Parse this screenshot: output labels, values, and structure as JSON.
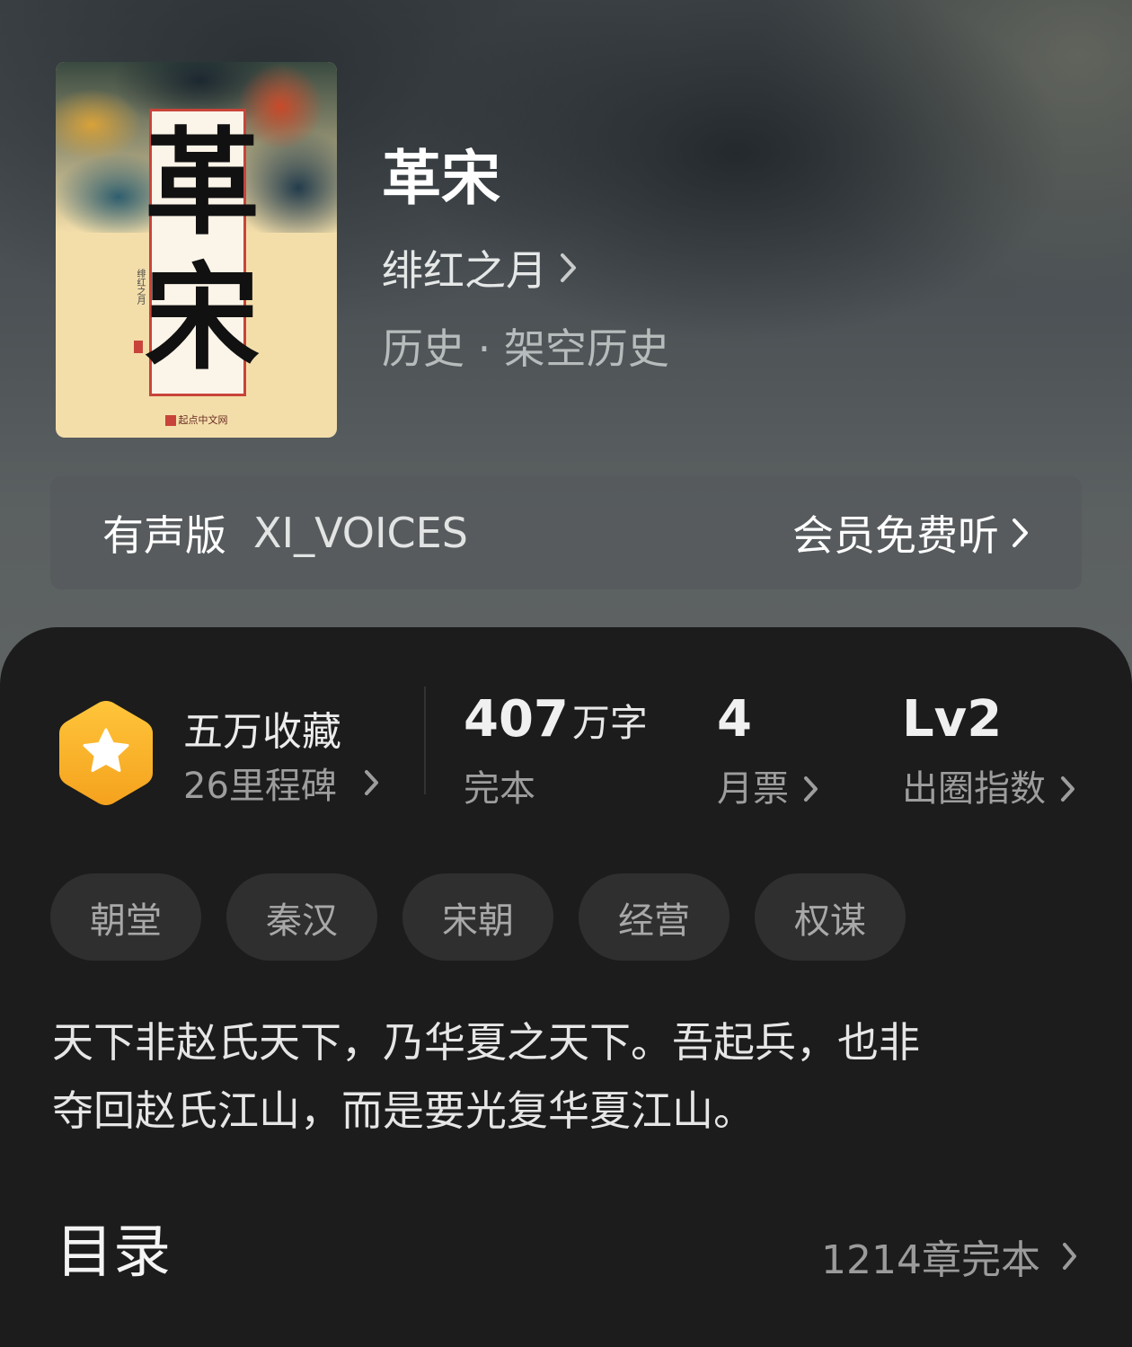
{
  "book": {
    "title": "革宋",
    "author": "绯红之月",
    "genre": "历史 · 架空历史",
    "cover": {
      "title_line1": "革",
      "title_line2": "宋",
      "author_vertical": "绯红之月",
      "publisher": "起点中文网"
    }
  },
  "audio": {
    "label": "有声版",
    "narrator": "XI_VOICES",
    "cta": "会员免费听"
  },
  "stats": {
    "collection": {
      "title": "五万收藏",
      "milestone": "26里程碑"
    },
    "words": {
      "value": "407",
      "unit": "万字",
      "label": "完本"
    },
    "monthly_ticket": {
      "value": "4",
      "label": "月票"
    },
    "circle_index": {
      "value": "Lv2",
      "label": "出圈指数"
    }
  },
  "tags": [
    "朝堂",
    "秦汉",
    "宋朝",
    "经营",
    "权谋"
  ],
  "synopsis": {
    "line1": "天下非赵氏天下，乃华夏之天下。吾起兵，也非",
    "line2": "夺回赵氏江山，而是要光复华夏江山。"
  },
  "toc": {
    "title": "目录",
    "count": "1214章完本"
  },
  "colors": {
    "badge_gradient_top": "#ffc53a",
    "badge_gradient_bottom": "#f5a21e",
    "sheet_bg": "#1c1c1c",
    "tag_bg": "#2f2f2f"
  },
  "icons": {
    "badge": "star-hexagon-icon",
    "chevron": "chevron-right-icon"
  }
}
